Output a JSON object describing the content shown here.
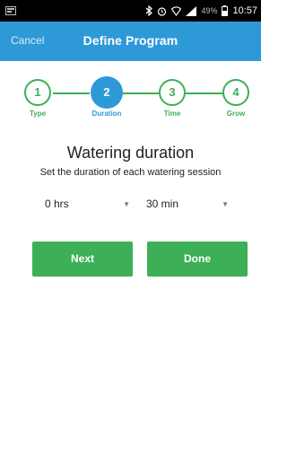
{
  "status_bar": {
    "battery_percent": "49%",
    "time": "10:57"
  },
  "app_bar": {
    "cancel_label": "Cancel",
    "title": "Define Program"
  },
  "stepper": {
    "steps": [
      {
        "number": "1",
        "label": "Type"
      },
      {
        "number": "2",
        "label": "Duration"
      },
      {
        "number": "3",
        "label": "Time"
      },
      {
        "number": "4",
        "label": "Grow"
      }
    ],
    "active_index": 1
  },
  "content": {
    "heading": "Watering duration",
    "subheading": "Set the duration of each watering session",
    "hours_value": "0 hrs",
    "minutes_value": "30 min"
  },
  "buttons": {
    "next_label": "Next",
    "done_label": "Done"
  },
  "colors": {
    "primary_blue": "#2d9ad7",
    "accent_green": "#3daf57",
    "status_bar": "#000000"
  }
}
